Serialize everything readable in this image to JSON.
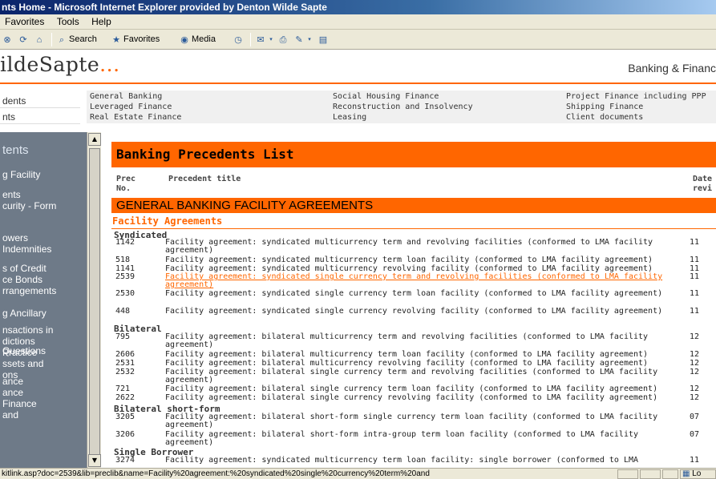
{
  "window": {
    "title": "nts Home - Microsoft Internet Explorer provided by Denton Wilde Sapte"
  },
  "menu": [
    "Favorites",
    "Tools",
    "Help"
  ],
  "toolbar": {
    "search_label": "Search",
    "favorites_label": "Favorites",
    "media_label": "Media"
  },
  "header": {
    "brand": "ildeSapte",
    "brand_dots": "...",
    "section_title": "Banking & Financ"
  },
  "left_tabs": [
    "dents",
    "nts"
  ],
  "categories": [
    [
      "General Banking",
      "Social Housing Finance",
      "Project Finance including PPP"
    ],
    [
      "Leveraged Finance",
      "Reconstruction and Insolvency",
      "Shipping Finance"
    ],
    [
      "Real Estate Finance",
      "Leasing",
      "Client documents"
    ]
  ],
  "leftnav": {
    "heading": "tents",
    "items": [
      "g Facility",
      "ents\ncurity - Form",
      "owers\nIndemnities",
      "s of Credit\nce Bonds\nrrangements",
      "g Ancillary",
      "nsactions in\ndictions\nPractice",
      "Questions",
      "ssets and\nons",
      "ance\nance\nFinance\nand"
    ]
  },
  "main": {
    "page_title": "Banking Precedents List",
    "col_no": "Prec\nNo.",
    "col_title": "Precedent title",
    "col_date": "Date\nrevi",
    "section": "GENERAL BANKING FACILITY AGREEMENTS",
    "subsection": "Facility Agreements",
    "groups": {
      "syndicated": "Syndicated",
      "bilateral": "Bilateral",
      "bilateral_short": "Bilateral short-form",
      "single_borrower": "Single Borrower"
    },
    "rows": [
      {
        "no": "1142",
        "title": "Facility agreement: syndicated multicurrency term and revolving facilities (conformed to LMA facility agreement)",
        "date": "11"
      },
      {
        "no": "518",
        "title": "Facility agreement: syndicated multicurrency term loan facility (conformed to LMA facility agreement)",
        "date": "11"
      },
      {
        "no": "1141",
        "title": "Facility agreement: syndicated multicurrency revolving facility (conformed to LMA facility agreement)",
        "date": "11"
      },
      {
        "no": "2539",
        "title": "Facility agreement: syndicated single currency term and revolving facilities (conformed to LMA facility agreement)",
        "date": "11"
      },
      {
        "no": "2530",
        "title": "Facility agreement: syndicated single currency term loan facility (conformed to LMA facility agreement)",
        "date": "11"
      },
      {
        "no": "448",
        "title": "Facility agreement: syndicated single currency revolving facility (conformed to LMA facility agreement)",
        "date": "11"
      },
      {
        "no": "795",
        "title": "Facility agreement: bilateral multicurrency term and revolving facilities (conformed to LMA facility agreement)",
        "date": "12"
      },
      {
        "no": "2606",
        "title": "Facility agreement: bilateral multicurrency term loan facility (conformed to LMA facility agreement)",
        "date": "12"
      },
      {
        "no": "2531",
        "title": "Facility agreement: bilateral multicurrency revolving facility (conformed to LMA facility agreement)",
        "date": "12"
      },
      {
        "no": "2532",
        "title": "Facility agreement: bilateral single currency term and revolving facilities (conformed to LMA facility agreement)",
        "date": "12"
      },
      {
        "no": "721",
        "title": "Facility agreement: bilateral single currency term loan facility (conformed to LMA facility agreement)",
        "date": "12"
      },
      {
        "no": "2622",
        "title": "Facility agreement: bilateral single currency revolving facility (conformed to LMA facility agreement)",
        "date": "12"
      },
      {
        "no": "3205",
        "title": "Facility agreement: bilateral short-form single currency term loan facility (conformed to LMA facility agreement)",
        "date": "07"
      },
      {
        "no": "3206",
        "title": "Facility agreement: bilateral short-form intra-group term loan facility (conformed to LMA facility agreement)",
        "date": "07"
      },
      {
        "no": "3274",
        "title": "Facility agreement: syndicated multicurrency term loan facility: single borrower (conformed to LMA",
        "date": "11"
      }
    ]
  },
  "status": {
    "url": "kitlink.asp?doc=2539&lib=preclib&name=Facility%20agreement:%20syndicated%20single%20currency%20term%20and",
    "zone": "Lo"
  }
}
